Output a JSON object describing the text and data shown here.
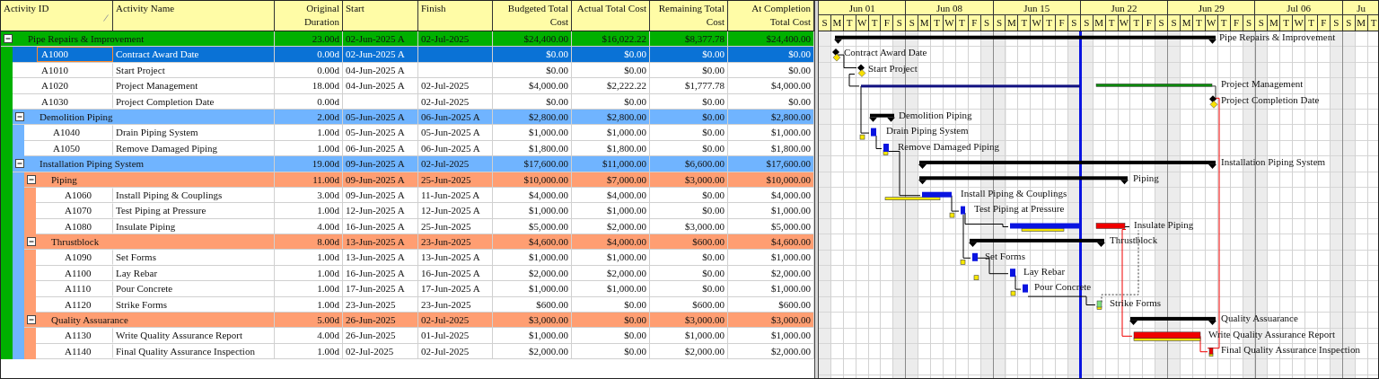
{
  "table": {
    "columns": [
      "Activity ID",
      "Activity Name",
      "Original Duration",
      "Start",
      "Finish",
      "Budgeted Total Cost",
      "Actual Total Cost",
      "Remaining Total Cost",
      "At Completion Total Cost"
    ],
    "rows": [
      {
        "kind": "wbs",
        "name": "Pipe Repairs & Improvement",
        "color": "#00b000",
        "expanded": true,
        "duration": "23.00d",
        "start": "02-Jun-2025 A",
        "finish": "02-Jul-2025",
        "budgeted_total_cost": "$24,400.00",
        "actual_total_cost": "$16,022.22",
        "remaining_total_cost": "$8,377.78",
        "at_completion_total_cost": "$24,400.00",
        "children": [
          {
            "kind": "activity",
            "id": "A1000",
            "name": "Contract Award Date",
            "selected": true,
            "duration": "0.00d",
            "start": "02-Jun-2025 A",
            "budgeted_total_cost": "$0.00",
            "actual_total_cost": "$0.00",
            "remaining_total_cost": "$0.00",
            "at_completion_total_cost": "$0.00"
          },
          {
            "kind": "activity",
            "id": "A1010",
            "name": "Start Project",
            "selected": false,
            "duration": "0.00d",
            "start": "04-Jun-2025 A",
            "budgeted_total_cost": "$0.00",
            "actual_total_cost": "$0.00",
            "remaining_total_cost": "$0.00",
            "at_completion_total_cost": "$0.00"
          },
          {
            "kind": "activity",
            "id": "A1020",
            "name": "Project Management",
            "selected": false,
            "duration": "18.00d",
            "start": "04-Jun-2025 A",
            "finish": "02-Jul-2025",
            "budgeted_total_cost": "$4,000.00",
            "actual_total_cost": "$2,222.22",
            "remaining_total_cost": "$1,777.78",
            "at_completion_total_cost": "$4,000.00"
          },
          {
            "kind": "activity",
            "id": "A1030",
            "name": "Project Completion Date",
            "selected": false,
            "duration": "0.00d",
            "finish": "02-Jul-2025",
            "budgeted_total_cost": "$0.00",
            "actual_total_cost": "$0.00",
            "remaining_total_cost": "$0.00",
            "at_completion_total_cost": "$0.00"
          },
          {
            "kind": "wbs",
            "name": "Demolition Piping",
            "color": "#70b4ff",
            "expanded": true,
            "duration": "2.00d",
            "start": "05-Jun-2025 A",
            "finish": "06-Jun-2025 A",
            "budgeted_total_cost": "$2,800.00",
            "actual_total_cost": "$2,800.00",
            "remaining_total_cost": "$0.00",
            "at_completion_total_cost": "$2,800.00",
            "children": [
              {
                "kind": "activity",
                "id": "A1040",
                "name": "Drain Piping System",
                "selected": false,
                "duration": "1.00d",
                "start": "05-Jun-2025 A",
                "finish": "05-Jun-2025 A",
                "budgeted_total_cost": "$1,000.00",
                "actual_total_cost": "$1,000.00",
                "remaining_total_cost": "$0.00",
                "at_completion_total_cost": "$1,000.00"
              },
              {
                "kind": "activity",
                "id": "A1050",
                "name": "Remove Damaged Piping",
                "selected": false,
                "duration": "1.00d",
                "start": "06-Jun-2025 A",
                "finish": "06-Jun-2025 A",
                "budgeted_total_cost": "$1,800.00",
                "actual_total_cost": "$1,800.00",
                "remaining_total_cost": "$0.00",
                "at_completion_total_cost": "$1,800.00"
              }
            ]
          },
          {
            "kind": "wbs",
            "name": "Installation Piping System",
            "color": "#70b4ff",
            "expanded": true,
            "duration": "19.00d",
            "start": "09-Jun-2025 A",
            "finish": "02-Jul-2025",
            "budgeted_total_cost": "$17,600.00",
            "actual_total_cost": "$11,000.00",
            "remaining_total_cost": "$6,600.00",
            "at_completion_total_cost": "$17,600.00",
            "children": [
              {
                "kind": "wbs",
                "name": "Piping",
                "color": "#ff9e72",
                "expanded": true,
                "duration": "11.00d",
                "start": "09-Jun-2025 A",
                "finish": "25-Jun-2025",
                "budgeted_total_cost": "$10,000.00",
                "actual_total_cost": "$7,000.00",
                "remaining_total_cost": "$3,000.00",
                "at_completion_total_cost": "$10,000.00",
                "children": [
                  {
                    "kind": "activity",
                    "id": "A1060",
                    "name": "Install Piping & Couplings",
                    "selected": false,
                    "duration": "3.00d",
                    "start": "09-Jun-2025 A",
                    "finish": "11-Jun-2025 A",
                    "budgeted_total_cost": "$4,000.00",
                    "actual_total_cost": "$4,000.00",
                    "remaining_total_cost": "$0.00",
                    "at_completion_total_cost": "$4,000.00"
                  },
                  {
                    "kind": "activity",
                    "id": "A1070",
                    "name": "Test Piping at Pressure",
                    "selected": false,
                    "duration": "1.00d",
                    "start": "12-Jun-2025 A",
                    "finish": "12-Jun-2025 A",
                    "budgeted_total_cost": "$1,000.00",
                    "actual_total_cost": "$1,000.00",
                    "remaining_total_cost": "$0.00",
                    "at_completion_total_cost": "$1,000.00"
                  },
                  {
                    "kind": "activity",
                    "id": "A1080",
                    "name": "Insulate Piping",
                    "selected": false,
                    "duration": "4.00d",
                    "start": "16-Jun-2025 A",
                    "finish": "25-Jun-2025",
                    "budgeted_total_cost": "$5,000.00",
                    "actual_total_cost": "$2,000.00",
                    "remaining_total_cost": "$3,000.00",
                    "at_completion_total_cost": "$5,000.00"
                  }
                ]
              },
              {
                "kind": "wbs",
                "name": "Thrustblock",
                "color": "#ff9e72",
                "expanded": true,
                "duration": "8.00d",
                "start": "13-Jun-2025 A",
                "finish": "23-Jun-2025",
                "budgeted_total_cost": "$4,600.00",
                "actual_total_cost": "$4,000.00",
                "remaining_total_cost": "$600.00",
                "at_completion_total_cost": "$4,600.00",
                "children": [
                  {
                    "kind": "activity",
                    "id": "A1090",
                    "name": "Set Forms",
                    "selected": false,
                    "duration": "1.00d",
                    "start": "13-Jun-2025 A",
                    "finish": "13-Jun-2025 A",
                    "budgeted_total_cost": "$1,000.00",
                    "actual_total_cost": "$1,000.00",
                    "remaining_total_cost": "$0.00",
                    "at_completion_total_cost": "$1,000.00"
                  },
                  {
                    "kind": "activity",
                    "id": "A1100",
                    "name": "Lay Rebar",
                    "selected": false,
                    "duration": "1.00d",
                    "start": "16-Jun-2025 A",
                    "finish": "16-Jun-2025 A",
                    "budgeted_total_cost": "$2,000.00",
                    "actual_total_cost": "$2,000.00",
                    "remaining_total_cost": "$0.00",
                    "at_completion_total_cost": "$2,000.00"
                  },
                  {
                    "kind": "activity",
                    "id": "A1110",
                    "name": "Pour Concrete",
                    "selected": false,
                    "duration": "1.00d",
                    "start": "17-Jun-2025 A",
                    "finish": "17-Jun-2025 A",
                    "budgeted_total_cost": "$1,000.00",
                    "actual_total_cost": "$1,000.00",
                    "remaining_total_cost": "$0.00",
                    "at_completion_total_cost": "$1,000.00"
                  },
                  {
                    "kind": "activity",
                    "id": "A1120",
                    "name": "Strike Forms",
                    "selected": false,
                    "duration": "1.00d",
                    "start": "23-Jun-2025",
                    "finish": "23-Jun-2025",
                    "budgeted_total_cost": "$600.00",
                    "actual_total_cost": "$0.00",
                    "remaining_total_cost": "$600.00",
                    "at_completion_total_cost": "$600.00"
                  }
                ]
              },
              {
                "kind": "wbs",
                "name": "Quality Assuarance",
                "color": "#ff9e72",
                "expanded": true,
                "duration": "5.00d",
                "start": "26-Jun-2025",
                "finish": "02-Jul-2025",
                "budgeted_total_cost": "$3,000.00",
                "actual_total_cost": "$0.00",
                "remaining_total_cost": "$3,000.00",
                "at_completion_total_cost": "$3,000.00",
                "children": [
                  {
                    "kind": "activity",
                    "id": "A1130",
                    "name": "Write Quality Assurance Report",
                    "selected": false,
                    "duration": "4.00d",
                    "start": "26-Jun-2025",
                    "finish": "01-Jul-2025",
                    "budgeted_total_cost": "$1,000.00",
                    "actual_total_cost": "$0.00",
                    "remaining_total_cost": "$1,000.00",
                    "at_completion_total_cost": "$1,000.00"
                  },
                  {
                    "kind": "activity",
                    "id": "A1140",
                    "name": "Final Quality Assurance Inspection",
                    "selected": false,
                    "duration": "1.00d",
                    "start": "02-Jul-2025",
                    "finish": "02-Jul-2025",
                    "budgeted_total_cost": "$2,000.00",
                    "actual_total_cost": "$0.00",
                    "remaining_total_cost": "$2,000.00",
                    "at_completion_total_cost": "$2,000.00"
                  }
                ]
              }
            ]
          }
        ]
      }
    ]
  },
  "gantt": {
    "timescale": [
      {
        "label": "Jun 01",
        "days": [
          "S",
          "M",
          "T",
          "W",
          "T",
          "F",
          "S"
        ]
      },
      {
        "label": "Jun 08",
        "days": [
          "S",
          "M",
          "T",
          "W",
          "T",
          "F",
          "S"
        ]
      },
      {
        "label": "Jun 15",
        "days": [
          "S",
          "M",
          "T",
          "W",
          "T",
          "F",
          "S"
        ]
      },
      {
        "label": "Jun 22",
        "days": [
          "S",
          "M",
          "T",
          "W",
          "T",
          "F",
          "S"
        ]
      },
      {
        "label": "Jun 29",
        "days": [
          "S",
          "M",
          "T",
          "W",
          "T",
          "F",
          "S"
        ]
      },
      {
        "label": "Jul 06",
        "days": [
          "S",
          "M",
          "T",
          "W",
          "T",
          "F",
          "S"
        ]
      },
      {
        "label": "Ju",
        "days": [
          "S",
          "M",
          "T"
        ]
      }
    ],
    "labels": [
      "Pipe Repairs & Improvement",
      "Contract Award Date",
      "Start Project",
      "Project Management",
      "Project Completion Date",
      "Demolition Piping",
      "Drain Piping System",
      "Remove Damaged Piping",
      "Installation Piping System",
      "Piping",
      "Install Piping & Couplings",
      "Test Piping at Pressure",
      "Insulate Piping",
      "Thrustblock",
      "Set Forms",
      "Lay Rebar",
      "Pour Concrete",
      "Strike Forms",
      "Quality Assuarance",
      "Write Quality Assurance Report",
      "Final Quality Assurance Inspection"
    ]
  }
}
